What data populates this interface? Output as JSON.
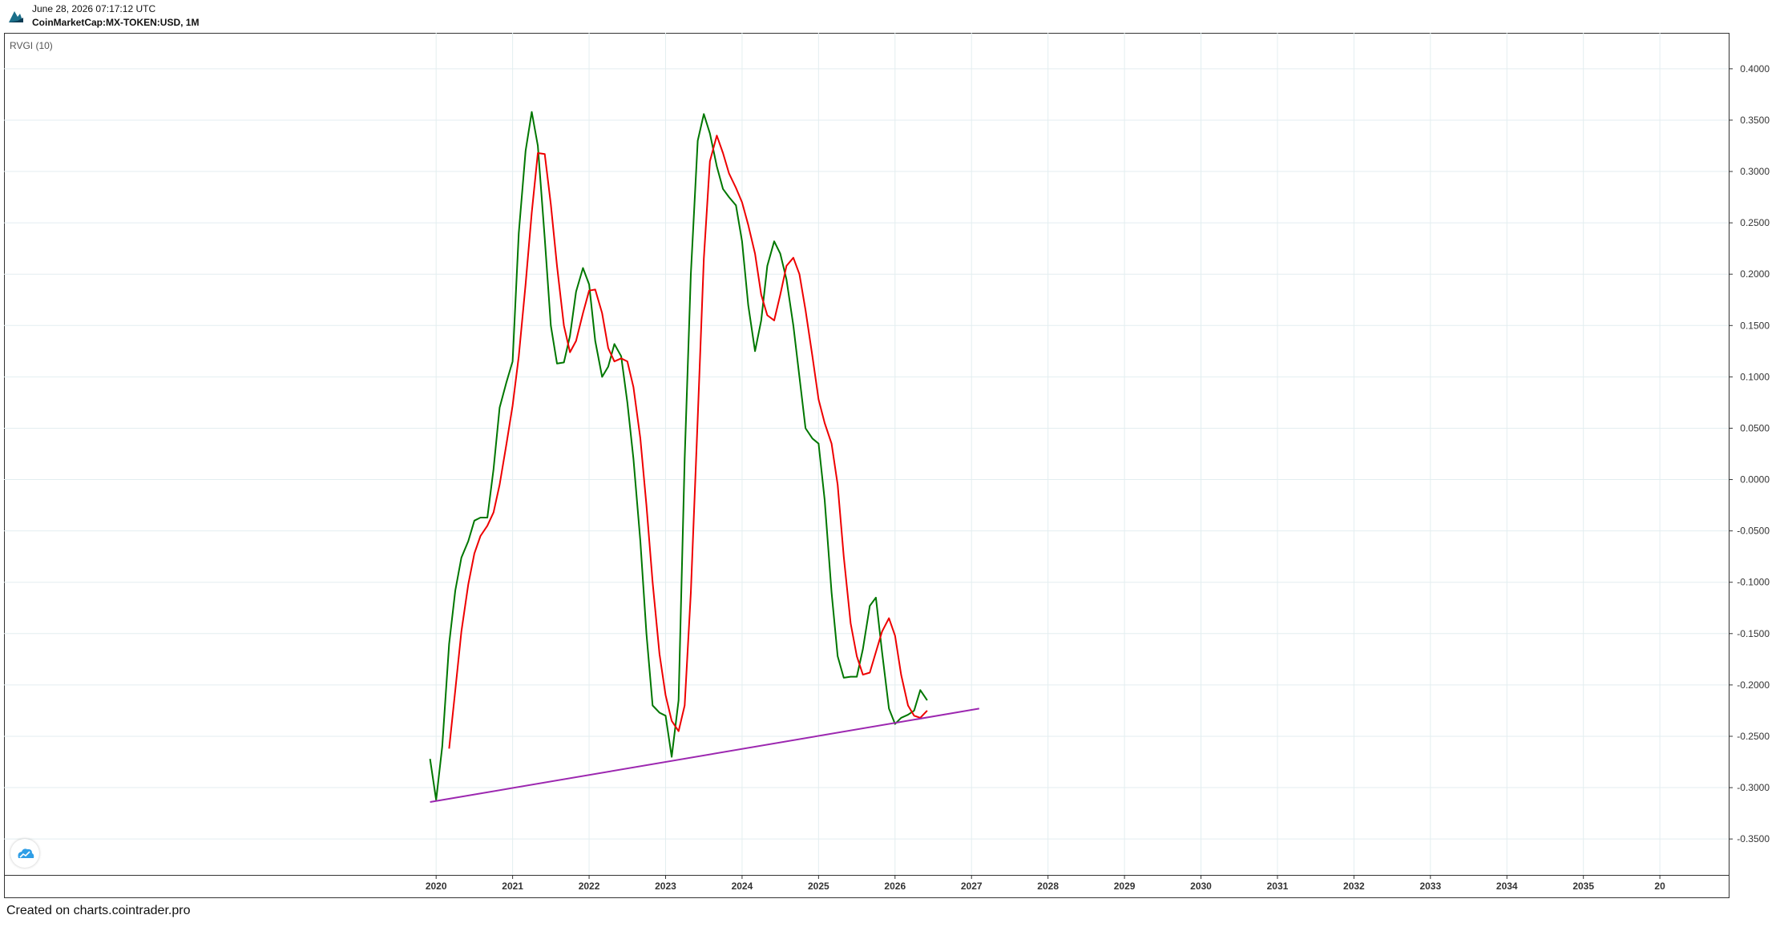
{
  "header": {
    "timestamp": "June 28, 2026 07:17:12 UTC",
    "symbol": "CoinMarketCap:MX-TOKEN:USD, 1M"
  },
  "footer": {
    "credit": "Created on charts.cointrader.pro"
  },
  "icons": {
    "logo": "chart-logo-icon",
    "brand": "cloud-chart-icon"
  },
  "colors": {
    "rvgi": "#007700",
    "signal": "#ee0000",
    "trendline": "#9c27b0",
    "grid": "#e3eef0",
    "axis_text": "#333333"
  },
  "chart_data": {
    "type": "line",
    "title": "RVGI (10)",
    "xlabel": "",
    "ylabel": "",
    "x_ticks": [
      "2020",
      "2021",
      "2022",
      "2023",
      "2024",
      "2025",
      "2026",
      "2027",
      "2028",
      "2029",
      "2030",
      "2031",
      "2032",
      "2033",
      "2034",
      "2035",
      "20"
    ],
    "y_ticks": [
      "0.4000",
      "0.3500",
      "0.3000",
      "0.2500",
      "0.2000",
      "0.1500",
      "0.1000",
      "0.0500",
      "0.0000",
      "-0.0500",
      "-0.1000",
      "-0.1500",
      "-0.2000",
      "-0.2500",
      "-0.3000",
      "-0.3500"
    ],
    "ylim": [
      -0.385,
      0.435
    ],
    "xlim": [
      2014.35,
      2036.9
    ],
    "grid": true,
    "series": [
      {
        "key": "rvgi",
        "x": [
          2019.92,
          2020.0,
          2020.08,
          2020.17,
          2020.25,
          2020.33,
          2020.42,
          2020.5,
          2020.58,
          2020.67,
          2020.75,
          2020.83,
          2020.92,
          2021.0,
          2021.08,
          2021.17,
          2021.25,
          2021.33,
          2021.42,
          2021.5,
          2021.58,
          2021.67,
          2021.75,
          2021.83,
          2021.92,
          2022.0,
          2022.08,
          2022.17,
          2022.25,
          2022.33,
          2022.42,
          2022.5,
          2022.58,
          2022.67,
          2022.75,
          2022.83,
          2022.92,
          2023.0,
          2023.08,
          2023.17,
          2023.25,
          2023.33,
          2023.42,
          2023.5,
          2023.58,
          2023.67,
          2023.75,
          2023.83,
          2023.92,
          2024.0,
          2024.08,
          2024.17,
          2024.25,
          2024.33,
          2024.42,
          2024.5,
          2024.58,
          2024.67,
          2024.75,
          2024.83,
          2024.92,
          2025.0,
          2025.08,
          2025.17,
          2025.25,
          2025.33,
          2025.42,
          2025.5,
          2025.58,
          2025.67,
          2025.75,
          2025.83,
          2025.92,
          2026.0,
          2026.08,
          2026.17,
          2026.25,
          2026.33,
          2026.42
        ],
        "values": [
          -0.272,
          -0.312,
          -0.26,
          -0.16,
          -0.108,
          -0.076,
          -0.06,
          -0.04,
          -0.037,
          -0.037,
          0.01,
          0.07,
          0.095,
          0.115,
          0.24,
          0.32,
          0.358,
          0.325,
          0.235,
          0.15,
          0.113,
          0.114,
          0.14,
          0.183,
          0.206,
          0.19,
          0.135,
          0.1,
          0.11,
          0.132,
          0.12,
          0.075,
          0.02,
          -0.06,
          -0.15,
          -0.22,
          -0.227,
          -0.23,
          -0.27,
          -0.215,
          0.02,
          0.2,
          0.33,
          0.356,
          0.337,
          0.305,
          0.283,
          0.275,
          0.267,
          0.232,
          0.17,
          0.125,
          0.155,
          0.208,
          0.232,
          0.22,
          0.195,
          0.15,
          0.1,
          0.05,
          0.04,
          0.035,
          -0.02,
          -0.11,
          -0.172,
          -0.193,
          -0.192,
          -0.192,
          -0.165,
          -0.123,
          -0.115,
          -0.168,
          -0.223,
          -0.238,
          -0.232,
          -0.229,
          -0.225,
          -0.205,
          -0.215
        ]
      },
      {
        "key": "signal",
        "x": [
          2020.17,
          2020.25,
          2020.33,
          2020.42,
          2020.5,
          2020.58,
          2020.67,
          2020.75,
          2020.83,
          2020.92,
          2021.0,
          2021.08,
          2021.17,
          2021.25,
          2021.33,
          2021.42,
          2021.5,
          2021.58,
          2021.67,
          2021.75,
          2021.83,
          2021.92,
          2022.0,
          2022.08,
          2022.17,
          2022.25,
          2022.33,
          2022.42,
          2022.5,
          2022.58,
          2022.67,
          2022.75,
          2022.83,
          2022.92,
          2023.0,
          2023.08,
          2023.17,
          2023.25,
          2023.33,
          2023.42,
          2023.5,
          2023.58,
          2023.67,
          2023.75,
          2023.83,
          2023.92,
          2024.0,
          2024.08,
          2024.17,
          2024.25,
          2024.33,
          2024.42,
          2024.5,
          2024.58,
          2024.67,
          2024.75,
          2024.83,
          2024.92,
          2025.0,
          2025.08,
          2025.17,
          2025.25,
          2025.33,
          2025.42,
          2025.5,
          2025.58,
          2025.67,
          2025.75,
          2025.83,
          2025.92,
          2026.0,
          2026.08,
          2026.17,
          2026.25,
          2026.33,
          2026.42
        ],
        "values": [
          -0.262,
          -0.205,
          -0.148,
          -0.102,
          -0.072,
          -0.055,
          -0.045,
          -0.032,
          -0.005,
          0.035,
          0.072,
          0.12,
          0.19,
          0.26,
          0.318,
          0.317,
          0.268,
          0.208,
          0.15,
          0.124,
          0.135,
          0.162,
          0.184,
          0.185,
          0.162,
          0.128,
          0.115,
          0.118,
          0.115,
          0.09,
          0.04,
          -0.025,
          -0.1,
          -0.17,
          -0.21,
          -0.235,
          -0.245,
          -0.22,
          -0.11,
          0.06,
          0.215,
          0.31,
          0.335,
          0.318,
          0.298,
          0.284,
          0.27,
          0.248,
          0.22,
          0.18,
          0.16,
          0.155,
          0.18,
          0.208,
          0.216,
          0.2,
          0.165,
          0.12,
          0.078,
          0.055,
          0.035,
          -0.005,
          -0.075,
          -0.14,
          -0.172,
          -0.19,
          -0.188,
          -0.168,
          -0.148,
          -0.135,
          -0.152,
          -0.19,
          -0.22,
          -0.23,
          -0.232,
          -0.225
        ]
      },
      {
        "key": "trendline",
        "x": [
          2019.92,
          2027.1
        ],
        "values": [
          -0.314,
          -0.223
        ]
      }
    ]
  }
}
